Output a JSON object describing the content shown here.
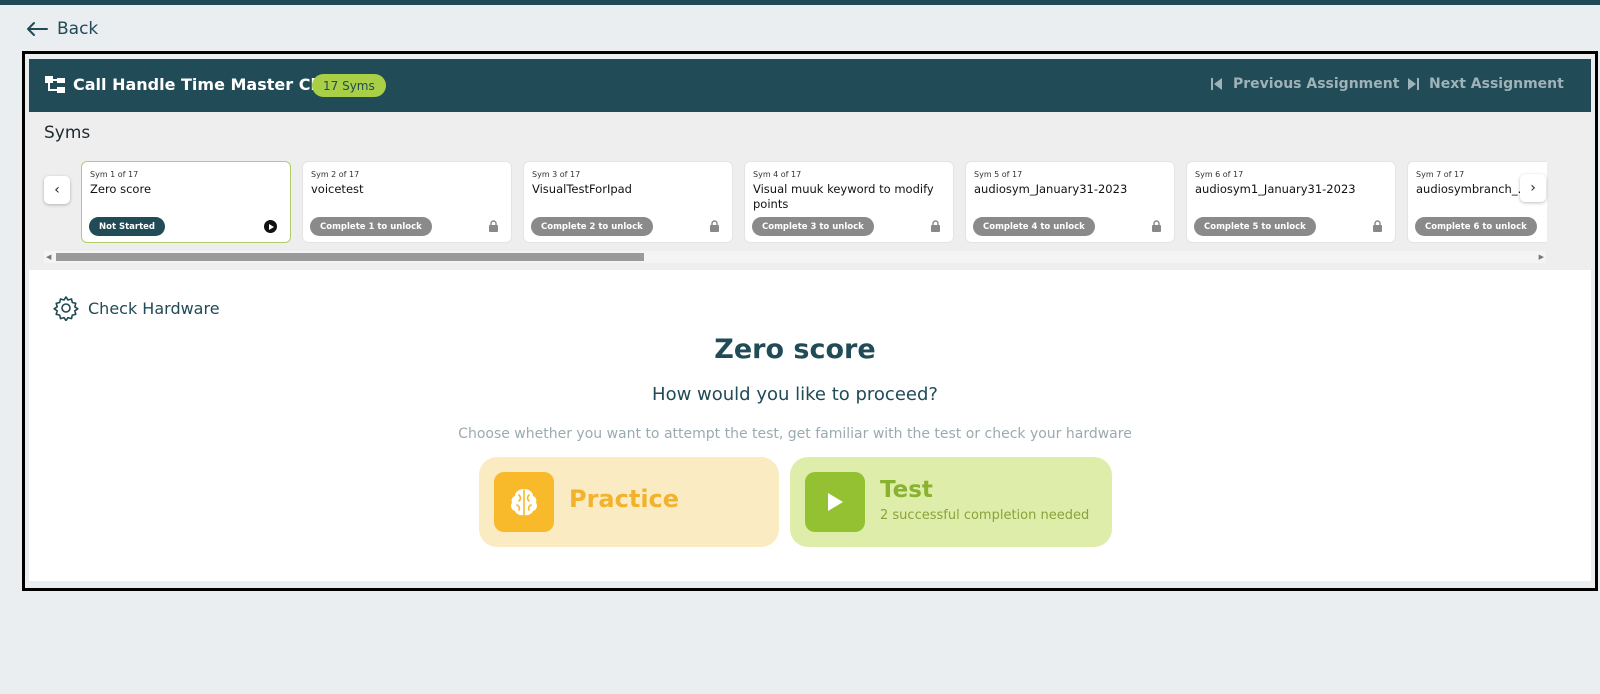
{
  "nav": {
    "back_label": "Back"
  },
  "header": {
    "course_title": "Call Handle Time Master Class",
    "sym_count": "17 Syms",
    "prev_label": "Previous Assignment",
    "next_label": "Next Assignment"
  },
  "syms": {
    "section_title": "Syms",
    "items": [
      {
        "index": "Sym 1 of 17",
        "name": "Zero score",
        "status": "Not Started"
      },
      {
        "index": "Sym 2 of 17",
        "name": "voicetest",
        "status": "Complete 1 to unlock"
      },
      {
        "index": "Sym 3 of 17",
        "name": "VisualTestForIpad",
        "status": "Complete 2 to unlock"
      },
      {
        "index": "Sym 4 of 17",
        "name": "Visual muuk keyword to modify points",
        "status": "Complete 3 to unlock"
      },
      {
        "index": "Sym 5 of 17",
        "name": "audiosym_January31-2023",
        "status": "Complete 4 to unlock"
      },
      {
        "index": "Sym 6 of 17",
        "name": "audiosym1_January31-2023",
        "status": "Complete 5 to unlock"
      },
      {
        "index": "Sym 7 of 17",
        "name": "audiosymbranch_...",
        "status": "Complete 6 to unlock"
      }
    ]
  },
  "main": {
    "hardware_label": "Check Hardware",
    "title": "Zero score",
    "subtitle": "How would you like to proceed?",
    "description": "Choose whether you want to attempt the test, get familiar with the test or check your hardware",
    "practice_label": "Practice",
    "test_label": "Test",
    "test_note": "2 successful completion needed"
  },
  "colors": {
    "brand_dark": "#214b56",
    "badge_green": "#a8cf45",
    "practice_bg": "#fbebc3",
    "practice_accent": "#f8b92b",
    "test_bg": "#dfedaa",
    "test_accent": "#93c131"
  }
}
